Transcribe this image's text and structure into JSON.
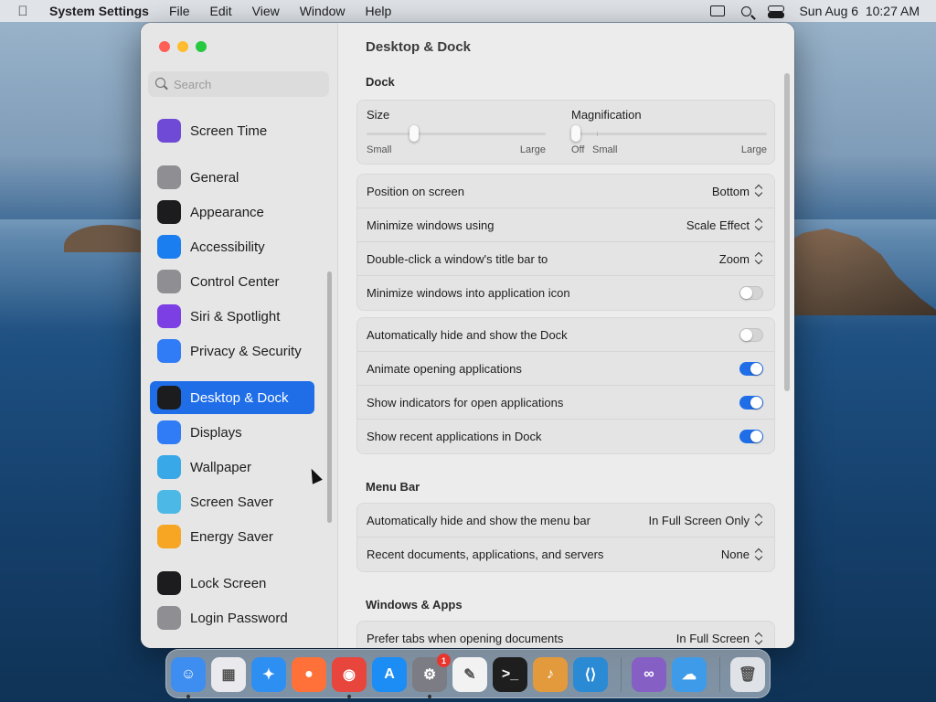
{
  "menubar": {
    "app_name": "System Settings",
    "items": [
      "File",
      "Edit",
      "View",
      "Window",
      "Help"
    ],
    "clock": "Sun Aug 6  10:27 AM"
  },
  "window": {
    "title": "Desktop & Dock",
    "search_placeholder": "Search",
    "sidebar_items": [
      {
        "label": "Screen Time",
        "icon": "hourglass-icon",
        "color": "#6e4ad6"
      },
      {
        "label": "General",
        "icon": "gear-icon",
        "color": "#8e8e93"
      },
      {
        "label": "Appearance",
        "icon": "appearance-icon",
        "color": "#1c1c1e"
      },
      {
        "label": "Accessibility",
        "icon": "accessibility-icon",
        "color": "#1a7ef0"
      },
      {
        "label": "Control Center",
        "icon": "control-center-icon",
        "color": "#8e8e93"
      },
      {
        "label": "Siri & Spotlight",
        "icon": "siri-icon",
        "color": "#7b3fe4"
      },
      {
        "label": "Privacy & Security",
        "icon": "hand-icon",
        "color": "#2f7cf6"
      },
      {
        "label": "Desktop & Dock",
        "icon": "dock-icon",
        "color": "#1c1c1e",
        "selected": true
      },
      {
        "label": "Displays",
        "icon": "sun-icon",
        "color": "#2f7cf6"
      },
      {
        "label": "Wallpaper",
        "icon": "flower-icon",
        "color": "#38a8e8"
      },
      {
        "label": "Screen Saver",
        "icon": "screen-saver-icon",
        "color": "#4cb8e6"
      },
      {
        "label": "Energy Saver",
        "icon": "bulb-icon",
        "color": "#f6a623"
      },
      {
        "label": "Lock Screen",
        "icon": "lock-icon",
        "color": "#1c1c1e"
      },
      {
        "label": "Login Password",
        "icon": "login-lock-icon",
        "color": "#8e8e93"
      }
    ],
    "sections": {
      "dock": "Dock",
      "menu_bar": "Menu Bar",
      "windows_apps": "Windows & Apps"
    },
    "dock_sliders": {
      "size": {
        "label": "Size",
        "min_label": "Small",
        "max_label": "Large",
        "value": 0.25
      },
      "magnification": {
        "label": "Magnification",
        "off_label": "Off",
        "min_label": "Small",
        "max_label": "Large",
        "value": 0.0
      }
    },
    "dock_popups": [
      {
        "label": "Position on screen",
        "value": "Bottom"
      },
      {
        "label": "Minimize windows using",
        "value": "Scale Effect"
      },
      {
        "label": "Double-click a window's title bar to",
        "value": "Zoom"
      }
    ],
    "minimize_into_icon": {
      "label": "Minimize windows into application icon",
      "on": false
    },
    "dock_toggles": [
      {
        "label": "Automatically hide and show the Dock",
        "on": false
      },
      {
        "label": "Animate opening applications",
        "on": true
      },
      {
        "label": "Show indicators for open applications",
        "on": true
      },
      {
        "label": "Show recent applications in Dock",
        "on": true
      }
    ],
    "menu_bar_rows": [
      {
        "label": "Automatically hide and show the menu bar",
        "value": "In Full Screen Only"
      },
      {
        "label": "Recent documents, applications, and servers",
        "value": "None"
      }
    ],
    "windows_rows": [
      {
        "label": "Prefer tabs when opening documents",
        "value": "In Full Screen"
      }
    ]
  },
  "dock": {
    "apps": [
      {
        "name": "finder-icon",
        "glyph": "☺",
        "color": "#3d8ef0",
        "running": true
      },
      {
        "name": "launchpad-icon",
        "glyph": "▦",
        "color": "#e9e9ee",
        "running": false
      },
      {
        "name": "safari-icon",
        "glyph": "✦",
        "color": "#2e8ff3",
        "running": false
      },
      {
        "name": "firefox-icon",
        "glyph": "●",
        "color": "#ff7139",
        "running": false
      },
      {
        "name": "chrome-icon",
        "glyph": "◉",
        "color": "#e8453c",
        "running": true
      },
      {
        "name": "app-store-icon",
        "glyph": "A",
        "color": "#1b8df5",
        "running": false
      },
      {
        "name": "system-settings-icon",
        "glyph": "⚙",
        "color": "#7c7c84",
        "running": true,
        "badge": "1"
      },
      {
        "name": "textedit-icon",
        "glyph": "✎",
        "color": "#f2f2f2",
        "running": false
      },
      {
        "name": "terminal-icon",
        "glyph": ">_",
        "color": "#1e1e1e",
        "running": false
      },
      {
        "name": "garageband-icon",
        "glyph": "♪",
        "color": "#e29a3c",
        "running": false
      },
      {
        "name": "vscode-icon",
        "glyph": "⟨⟩",
        "color": "#2a8ad4",
        "running": false
      },
      {
        "name": "visual-studio-icon",
        "glyph": "∞",
        "color": "#865fc5",
        "running": false
      },
      {
        "name": "weather-icon",
        "glyph": "☁",
        "color": "#3d9be9",
        "running": false
      },
      {
        "name": "trash-icon",
        "glyph": "🗑",
        "color": "#dfe2e6",
        "running": false
      }
    ]
  }
}
